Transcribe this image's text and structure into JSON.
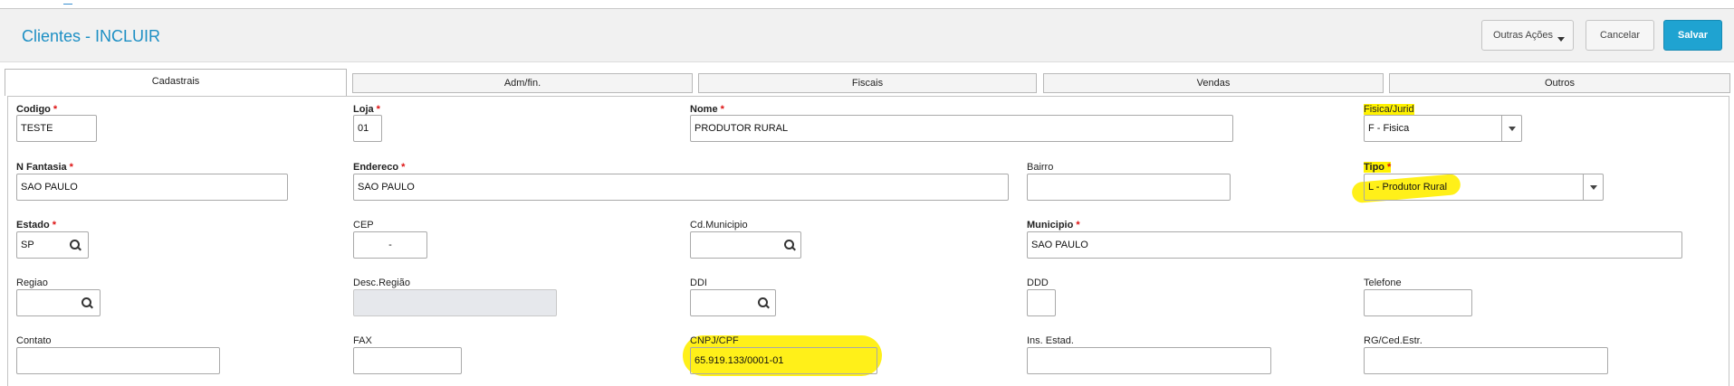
{
  "header": {
    "title": "Clientes - INCLUIR",
    "buttons": {
      "more": "Outras Ações",
      "cancel": "Cancelar",
      "save": "Salvar"
    }
  },
  "tabs": [
    "Cadastrais",
    "Adm/fin.",
    "Fiscais",
    "Vendas",
    "Outros"
  ],
  "active_tab": "Cadastrais",
  "colors": {
    "accent": "#1fa3d1",
    "title": "#1d8fc4",
    "required": "#dd1111",
    "highlight": "#fff200"
  },
  "fields": {
    "codigo": {
      "label": "Codigo",
      "value": "TESTE"
    },
    "loja": {
      "label": "Loja",
      "value": "01"
    },
    "nome": {
      "label": "Nome",
      "value": "PRODUTOR RURAL"
    },
    "fisica_jurid": {
      "label": "Fisica/Jurid",
      "value": "F - Fisica"
    },
    "n_fantasia": {
      "label": "N Fantasia",
      "value": "SAO PAULO"
    },
    "endereco": {
      "label": "Endereco",
      "value": "SAO PAULO"
    },
    "bairro": {
      "label": "Bairro",
      "value": ""
    },
    "tipo": {
      "label": "Tipo",
      "value": "L - Produtor Rural"
    },
    "estado": {
      "label": "Estado",
      "value": "SP"
    },
    "cep": {
      "label": "CEP",
      "value": " - "
    },
    "cd_municipio": {
      "label": "Cd.Municipio",
      "value": ""
    },
    "municipio": {
      "label": "Municipio",
      "value": "SAO PAULO"
    },
    "regiao": {
      "label": "Regiao",
      "value": ""
    },
    "desc_regiao": {
      "label": "Desc.Região",
      "value": ""
    },
    "ddi": {
      "label": "DDI",
      "value": ""
    },
    "ddd": {
      "label": "DDD",
      "value": ""
    },
    "telefone": {
      "label": "Telefone",
      "value": ""
    },
    "contato": {
      "label": "Contato",
      "value": ""
    },
    "fax": {
      "label": "FAX",
      "value": ""
    },
    "cnpj_cpf": {
      "label": "CNPJ/CPF",
      "value": "65.919.133/0001-01"
    },
    "ins_estad": {
      "label": "Ins. Estad.",
      "value": ""
    },
    "rg_ced_estr": {
      "label": "RG/Ced.Estr.",
      "value": ""
    }
  }
}
